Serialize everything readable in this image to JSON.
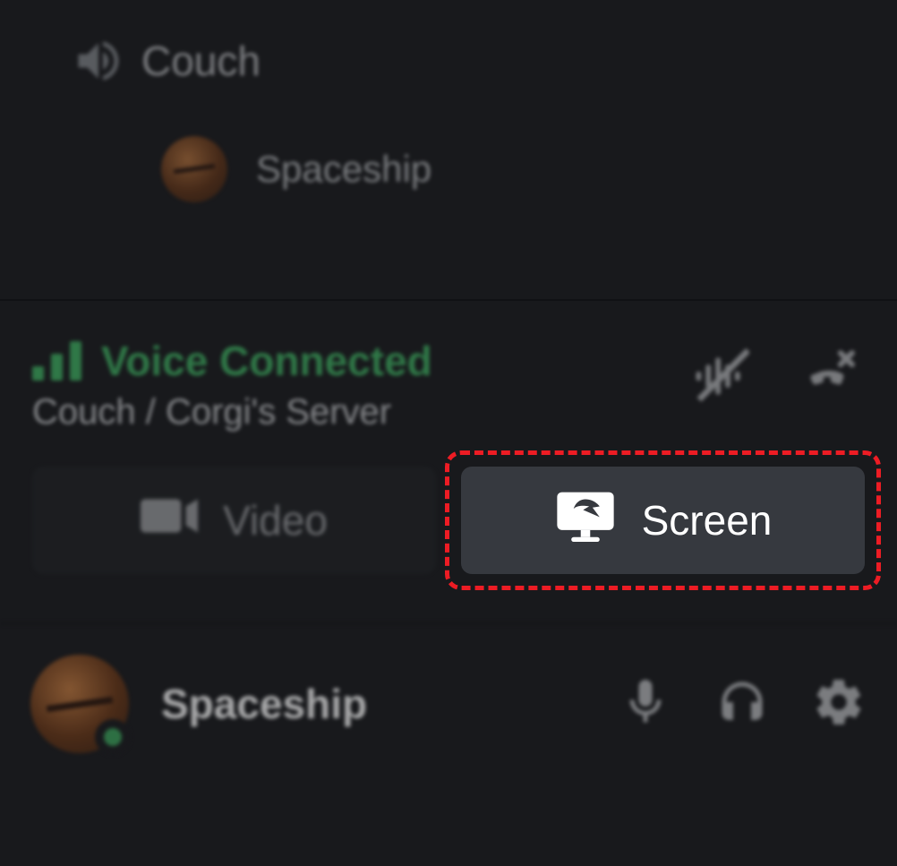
{
  "channel": {
    "name": "Couch",
    "members": [
      {
        "name": "Spaceship"
      }
    ]
  },
  "voice_panel": {
    "status": "Voice Connected",
    "path": "Couch / Corgi's Server",
    "video_label": "Video",
    "screen_label": "Screen"
  },
  "user": {
    "name": "Spaceship",
    "status": "online"
  },
  "colors": {
    "accent_green": "#3ba55c",
    "highlight_red": "#ed1c24"
  }
}
